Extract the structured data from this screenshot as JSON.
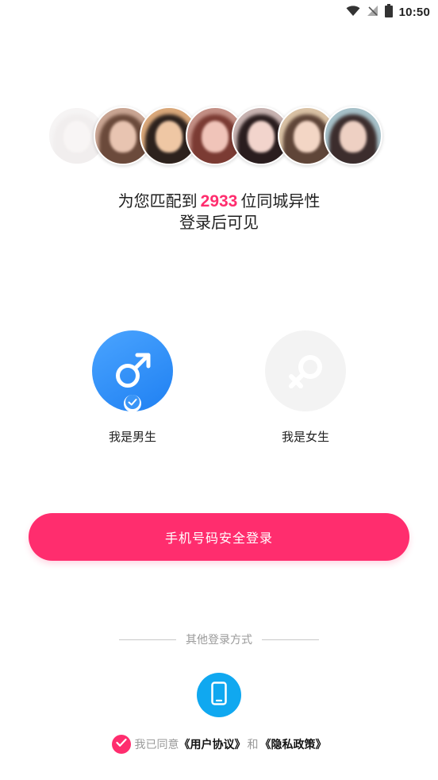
{
  "status_bar": {
    "time": "10:50",
    "icons": [
      "wifi-icon",
      "no-signal-icon",
      "battery-icon"
    ]
  },
  "avatars": [
    {
      "name": "avatar-1",
      "faded": true,
      "bg": "#f1eeee",
      "hair": "#e8e3e3",
      "face": "#f5f0ef"
    },
    {
      "name": "avatar-2",
      "bg": "#c9a593",
      "hair": "#6b4a3b",
      "face": "#e8c4b1"
    },
    {
      "name": "avatar-3",
      "bg": "#d9a779",
      "hair": "#2d221d",
      "face": "#efc7a4"
    },
    {
      "name": "avatar-4",
      "bg": "#c38f85",
      "hair": "#7b3b33",
      "face": "#f0c4b9"
    },
    {
      "name": "avatar-5",
      "bg": "#c7b2b0",
      "hair": "#2a1d1e",
      "face": "#f2d4cc"
    },
    {
      "name": "avatar-6",
      "bg": "#d9c1a4",
      "hair": "#5f4538",
      "face": "#f3d6c5"
    },
    {
      "name": "avatar-7",
      "bg": "#a6c0c8",
      "hair": "#3c2d2d",
      "face": "#eed0c3"
    }
  ],
  "match": {
    "prefix": "为您匹配到",
    "count": "2933",
    "suffix": "位同城异性",
    "line2": "登录后可见"
  },
  "gender": {
    "male_label": "我是男生",
    "female_label": "我是女生",
    "selected": "male"
  },
  "login_button_label": "手机号码安全登录",
  "other_login": {
    "label": "其他登录方式"
  },
  "agreement": {
    "prefix": "我已同意",
    "user_agreement": "《用户协议》",
    "and": "和",
    "privacy_policy": "《隐私政策》",
    "checked": true
  },
  "colors": {
    "accent": "#ff2d6e",
    "male_blue": "#2a8cf7",
    "phone_blue": "#10a8f0",
    "muted_text": "#9a9a9a"
  }
}
